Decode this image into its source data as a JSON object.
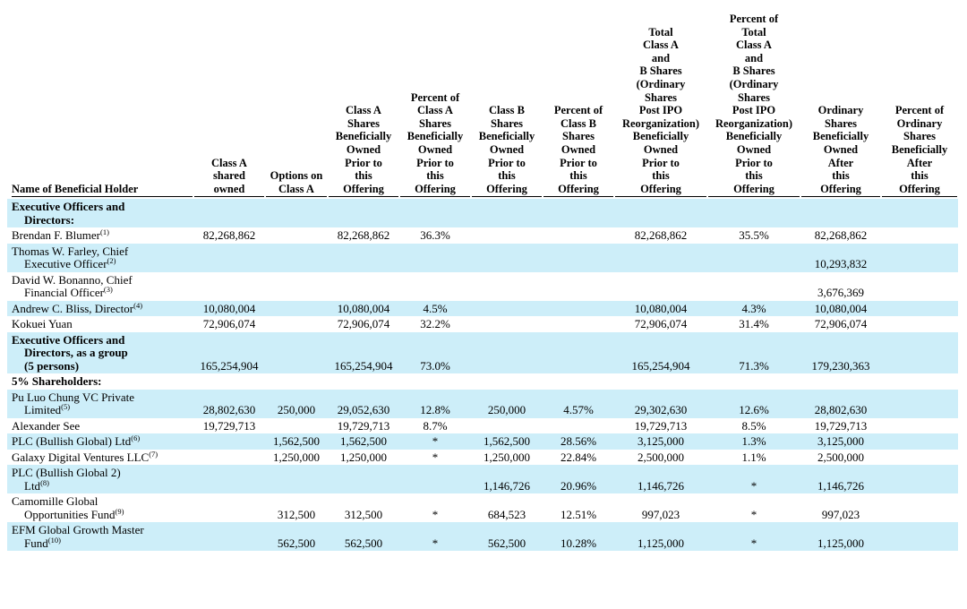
{
  "columns": [
    "Name of Beneficial Holder",
    "Class A\nshared\nowned",
    "Options on\nClass A",
    "Class A\nShares\nBeneficially\nOwned\nPrior to\nthis\nOffering",
    "Percent of\nClass A\nShares\nBeneficially\nOwned\nPrior to\nthis\nOffering",
    "Class B\nShares\nBeneficially\nOwned\nPrior to\nthis\nOffering",
    "Percent of\nClass B\nShares\nOwned\nPrior to\nthis\nOffering",
    "Total\nClass A\nand\nB Shares\n(Ordinary\nShares\nPost IPO\nReorganization)\nBeneficially\nOwned\nPrior to\nthis\nOffering",
    "Percent of\nTotal\nClass A\nand\nB Shares\n(Ordinary\nShares\nPost IPO\nReorganization)\nBeneficially\nOwned\nPrior to\nthis\nOffering",
    "Ordinary\nShares\nBeneficially\nOwned\nAfter\nthis\nOffering",
    "Percent of\nOrdinary\nShares\nBeneficially\nAfter\nthis\nOffering"
  ],
  "rows": [
    {
      "name1": "Executive Officers and",
      "name2": "Directors:",
      "sup": "",
      "section": true,
      "shade": true,
      "cells": [
        "",
        "",
        "",
        "",
        "",
        "",
        "",
        "",
        "",
        ""
      ]
    },
    {
      "name1": "Brendan F. Blumer",
      "name2": "",
      "sup": "(1)",
      "section": false,
      "shade": false,
      "cells": [
        "82,268,862",
        "",
        "82,268,862",
        "36.3%",
        "",
        "",
        "82,268,862",
        "35.5%",
        "82,268,862",
        ""
      ]
    },
    {
      "name1": "Thomas W. Farley, Chief",
      "name2": "Executive Officer",
      "sup": "(2)",
      "section": false,
      "shade": true,
      "cells": [
        "",
        "",
        "",
        "",
        "",
        "",
        "",
        "",
        "10,293,832",
        ""
      ]
    },
    {
      "name1": "David W. Bonanno, Chief",
      "name2": "Financial Officer",
      "sup": "(3)",
      "section": false,
      "shade": false,
      "cells": [
        "",
        "",
        "",
        "",
        "",
        "",
        "",
        "",
        "3,676,369",
        ""
      ]
    },
    {
      "name1": "Andrew C. Bliss, Director",
      "name2": "",
      "sup": "(4)",
      "section": false,
      "shade": true,
      "cells": [
        "10,080,004",
        "",
        "10,080,004",
        "4.5%",
        "",
        "",
        "10,080,004",
        "4.3%",
        "10,080,004",
        ""
      ]
    },
    {
      "name1": "Kokuei Yuan",
      "name2": "",
      "sup": "",
      "section": false,
      "shade": false,
      "cells": [
        "72,906,074",
        "",
        "72,906,074",
        "32.2%",
        "",
        "",
        "72,906,074",
        "31.4%",
        "72,906,074",
        ""
      ]
    },
    {
      "name1": "Executive Officers and",
      "name2": "Directors, as a group",
      "name3": "(5 persons)",
      "sup": "",
      "section": true,
      "shade": true,
      "cells": [
        "165,254,904",
        "",
        "165,254,904",
        "73.0%",
        "",
        "",
        "165,254,904",
        "71.3%",
        "179,230,363",
        ""
      ]
    },
    {
      "name1": "5% Shareholders:",
      "name2": "",
      "sup": "",
      "section": true,
      "shade": false,
      "cells": [
        "",
        "",
        "",
        "",
        "",
        "",
        "",
        "",
        "",
        ""
      ]
    },
    {
      "name1": "Pu Luo Chung VC Private",
      "name2": "Limited",
      "sup": "(5)",
      "section": false,
      "shade": true,
      "cells": [
        "28,802,630",
        "250,000",
        "29,052,630",
        "12.8%",
        "250,000",
        "4.57%",
        "29,302,630",
        "12.6%",
        "28,802,630",
        ""
      ]
    },
    {
      "name1": "Alexander See",
      "name2": "",
      "sup": "",
      "section": false,
      "shade": false,
      "cells": [
        "19,729,713",
        "",
        "19,729,713",
        "8.7%",
        "",
        "",
        "19,729,713",
        "8.5%",
        "19,729,713",
        ""
      ]
    },
    {
      "name1": "PLC (Bullish Global) Ltd",
      "name2": "",
      "sup": "(6)",
      "section": false,
      "shade": true,
      "cells": [
        "",
        "1,562,500",
        "1,562,500",
        "*",
        "1,562,500",
        "28.56%",
        "3,125,000",
        "1.3%",
        "3,125,000",
        ""
      ]
    },
    {
      "name1": "Galaxy Digital Ventures LLC",
      "name2": "",
      "sup": "(7)",
      "section": false,
      "shade": false,
      "cells": [
        "",
        "1,250,000",
        "1,250,000",
        "*",
        "1,250,000",
        "22.84%",
        "2,500,000",
        "1.1%",
        "2,500,000",
        ""
      ]
    },
    {
      "name1": "PLC (Bullish Global 2)",
      "name2": "Ltd",
      "sup": "(8)",
      "section": false,
      "shade": true,
      "cells": [
        "",
        "",
        "",
        "",
        "1,146,726",
        "20.96%",
        "1,146,726",
        "*",
        "1,146,726",
        ""
      ]
    },
    {
      "name1": "Camomille Global",
      "name2": "Opportunities Fund",
      "sup": "(9)",
      "section": false,
      "shade": false,
      "cells": [
        "",
        "312,500",
        "312,500",
        "*",
        "684,523",
        "12.51%",
        "997,023",
        "*",
        "997,023",
        ""
      ]
    },
    {
      "name1": "EFM Global Growth Master",
      "name2": "Fund",
      "sup": "(10)",
      "section": false,
      "shade": true,
      "cells": [
        "",
        "562,500",
        "562,500",
        "*",
        "562,500",
        "10.28%",
        "1,125,000",
        "*",
        "1,125,000",
        ""
      ]
    }
  ]
}
